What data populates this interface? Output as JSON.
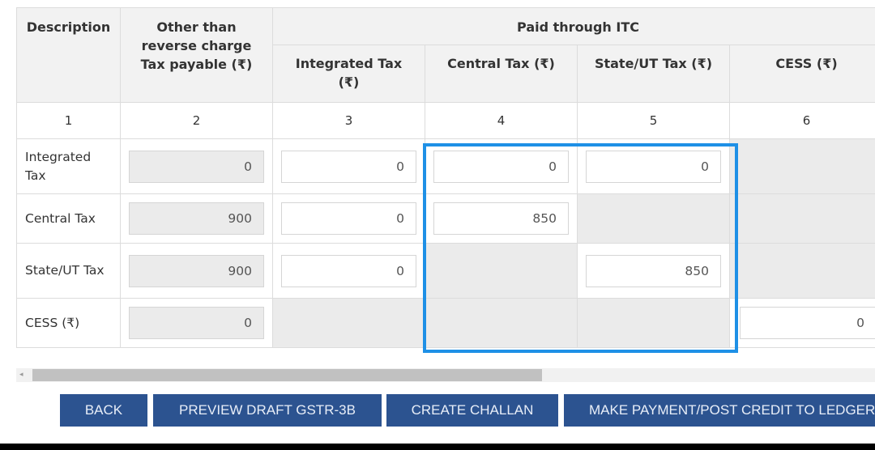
{
  "table": {
    "headers": {
      "description": "Description",
      "tax_payable": "Other than reverse charge Tax payable (₹)",
      "paid_through_itc": "Paid through ITC",
      "integrated_tax": "Integrated Tax (₹)",
      "central_tax": "Central Tax (₹)",
      "state_ut_tax": "State/UT Tax (₹)",
      "cess": "CESS (₹)"
    },
    "column_numbers": [
      "1",
      "2",
      "3",
      "4",
      "5",
      "6"
    ],
    "rows": [
      {
        "description": "Integrated Tax",
        "tax_payable": "0",
        "integrated_tax": "0",
        "central_tax": "0",
        "state_ut_tax": "0",
        "cess": null
      },
      {
        "description": "Central Tax",
        "tax_payable": "900",
        "integrated_tax": "0",
        "central_tax": "850",
        "state_ut_tax": null,
        "cess": null
      },
      {
        "description": "State/UT Tax",
        "tax_payable": "900",
        "integrated_tax": "0",
        "central_tax": null,
        "state_ut_tax": "850",
        "cess": null
      },
      {
        "description": "CESS (₹)",
        "tax_payable": "0",
        "integrated_tax": null,
        "central_tax": null,
        "state_ut_tax": null,
        "cess": "0"
      }
    ]
  },
  "buttons": {
    "back": "BACK",
    "preview": "PREVIEW DRAFT GSTR-3B",
    "challan": "CREATE CHALLAN",
    "payment": "MAKE PAYMENT/POST CREDIT TO LEDGER"
  },
  "scrollbar": {
    "arrow_icon": "◂",
    "position_fraction": 0.0
  },
  "colors": {
    "button_bg": "#2c5390",
    "highlight": "#1e90e6",
    "readonly_bg": "#ebebeb"
  }
}
